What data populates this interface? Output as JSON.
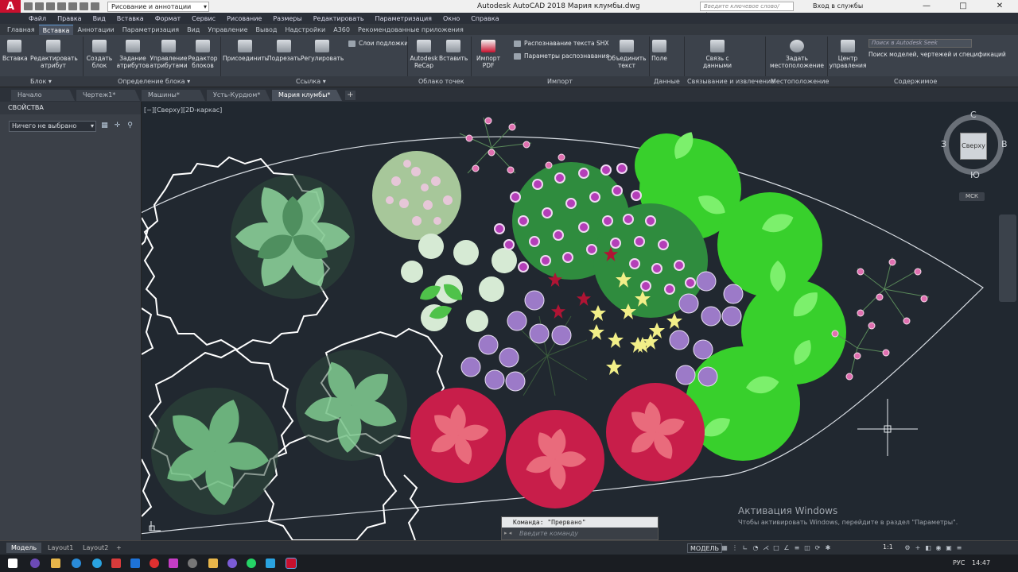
{
  "title_bar": {
    "app_logo": "A",
    "workspace": "Рисование и аннотации",
    "window_title": "Autodesk AutoCAD 2018   Мария клумбы.dwg",
    "search_placeholder": "Введите ключевое слово/фразу",
    "signin": "Вход в службы",
    "minimize": "—",
    "maximize": "□",
    "close": "✕"
  },
  "menu": [
    "Файл",
    "Правка",
    "Вид",
    "Вставка",
    "Формат",
    "Сервис",
    "Рисование",
    "Размеры",
    "Редактировать",
    "Параметризация",
    "Окно",
    "Справка"
  ],
  "ribbon_tabs": [
    "Главная",
    "Вставка",
    "Аннотации",
    "Параметризация",
    "Вид",
    "Управление",
    "Вывод",
    "Надстройки",
    "A360",
    "Рекомендованные приложения"
  ],
  "ribbon_active_tab": "Вставка",
  "ribbon": {
    "insert": "Вставка",
    "edit_attr": "Редактировать атрибут",
    "create_block": "Создать блок",
    "define_attrs": "Задание атрибутов",
    "manage_attrs": "Управление атрибутами",
    "block_editor": "Редактор блоков",
    "attach": "Присоединить",
    "clip": "Подрезать",
    "adjust": "Регулировать",
    "underlay_layers": "Слои подложки",
    "recap": "Autodesk ReCap",
    "paste": "Вставить",
    "import_pdf": "Импорт PDF",
    "shx_recognition": "Распознавание текста SHX",
    "recognition_settings": "Параметры распознавания",
    "combine_text": "Объединить текст",
    "field": "Поле",
    "data_link": "Связь с данными",
    "set_location": "Задать местоположение",
    "control_center": "Центр управления",
    "seek_placeholder": "Поиск в Autodesk Seek",
    "seek_caption": "Поиск моделей, чертежей и спецификаций",
    "panels": [
      "Блок ▾",
      "Определение блока ▾",
      "Ссылка ▾",
      "Облако точек",
      "Импорт",
      "Данные",
      "Связывание и извлечение",
      "Местоположение",
      "Содержимое"
    ]
  },
  "doc_tabs": [
    "Начало",
    "Чертеж1*",
    "Машины*",
    "Усть-Курдюм*",
    "Мария клумбы*"
  ],
  "doc_active_tab": "Мария клумбы*",
  "properties": {
    "title": "СВОЙСТВА",
    "selection": "Ничего не выбрано"
  },
  "viewport": {
    "label": "[−][Сверху][2D-каркас]"
  },
  "viewcube": {
    "face": "Сверху",
    "north": "С",
    "south": "Ю",
    "west": "З",
    "east": "В",
    "wcs": "МСК"
  },
  "command": {
    "last": "Команда: \"Прервано\"",
    "placeholder": "Введите команду"
  },
  "activation": {
    "title": "Активация Windows",
    "subtitle": "Чтобы активировать Windows, перейдите в раздел \"Параметры\"."
  },
  "model_tabs": [
    "Модель",
    "Layout1",
    "Layout2"
  ],
  "model_add": "+",
  "status": {
    "model": "МОДЕЛЬ",
    "scale": "1:1"
  },
  "taskbar": {
    "lang": "РУС",
    "time": "14:47"
  },
  "colors": {
    "canvas": "#212830",
    "accent": "#5f9ad8",
    "poinsettia": "#c81e4a",
    "lime": "#3ddc2c",
    "violet": "#9c7ac8"
  }
}
